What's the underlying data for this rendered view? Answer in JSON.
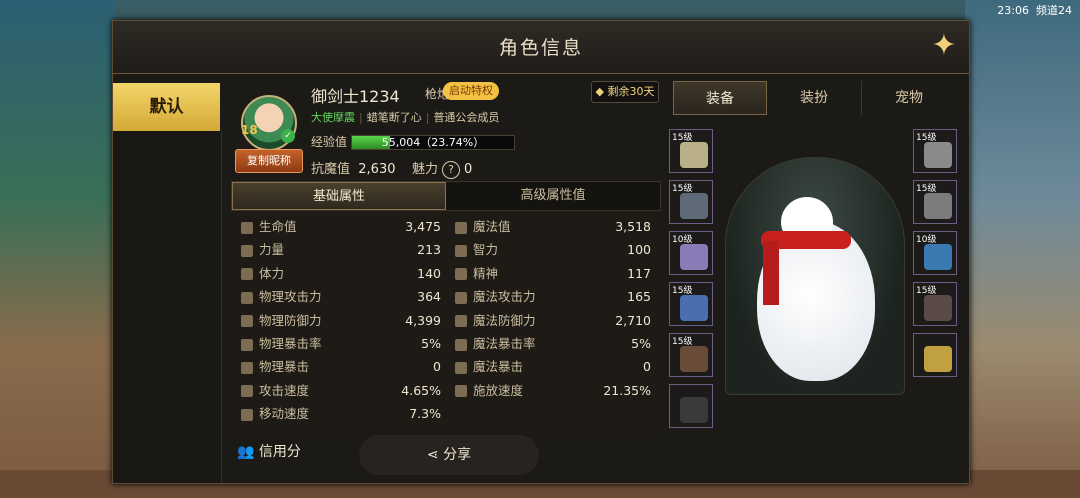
{
  "status": {
    "time": "23:06",
    "channel": "频道24"
  },
  "window": {
    "title": "角色信息",
    "close_icon": "close-star-icon"
  },
  "sidebar": {
    "default_tab": "默认"
  },
  "profile": {
    "name": "御剑士1234",
    "class": "枪炮师",
    "privilege": "启动特权",
    "level": "18",
    "tags": [
      "大使摩震",
      "蜡笔断了心",
      "普通公会成员"
    ],
    "copy_name": "复制昵称",
    "remaining": "剩余30天",
    "exp_label": "经验值",
    "exp_text": "55,004（23.74%）",
    "exp_fraction": 0.2374,
    "resist_label": "抗魔值",
    "resist_value": "2,630",
    "charm_label": "魅力",
    "charm_value": "0"
  },
  "attr_tabs": [
    "基础属性",
    "高级属性值"
  ],
  "attributes": [
    {
      "l_label": "生命值",
      "l_val": "3,475",
      "r_label": "魔法值",
      "r_val": "3,518"
    },
    {
      "l_label": "力量",
      "l_val": "213",
      "r_label": "智力",
      "r_val": "100"
    },
    {
      "l_label": "体力",
      "l_val": "140",
      "r_label": "精神",
      "r_val": "117"
    },
    {
      "l_label": "物理攻击力",
      "l_val": "364",
      "r_label": "魔法攻击力",
      "r_val": "165"
    },
    {
      "l_label": "物理防御力",
      "l_val": "4,399",
      "r_label": "魔法防御力",
      "r_val": "2,710"
    },
    {
      "l_label": "物理暴击率",
      "l_val": "5%",
      "r_label": "魔法暴击率",
      "r_val": "5%"
    },
    {
      "l_label": "物理暴击",
      "l_val": "0",
      "r_label": "魔法暴击",
      "r_val": "0"
    },
    {
      "l_label": "攻击速度",
      "l_val": "4.65%",
      "r_label": "施放速度",
      "r_val": "21.35%"
    },
    {
      "l_label": "移动速度",
      "l_val": "7.3%",
      "r_label": "",
      "r_val": ""
    }
  ],
  "bottom": {
    "credit": "信用分",
    "share": "分享"
  },
  "right_tabs": [
    "装备",
    "装扮",
    "宠物"
  ],
  "left_slots": [
    "15级",
    "15级",
    "10级",
    "15级",
    "15级",
    ""
  ],
  "right_slots": [
    "15级",
    "15级",
    "10级",
    "15级",
    ""
  ]
}
